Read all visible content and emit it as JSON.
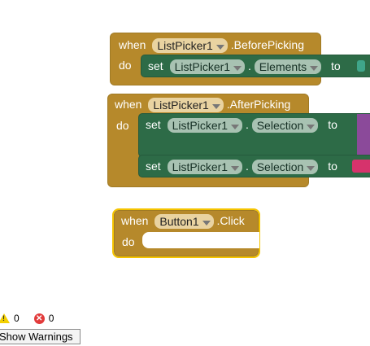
{
  "block1": {
    "when": "when",
    "component": "ListPicker1",
    "event": ".BeforePicking",
    "do": "do"
  },
  "block1_set": {
    "set": "set",
    "component": "ListPicker1",
    "dot": ".",
    "property": "Elements",
    "to": "to"
  },
  "block2": {
    "when": "when",
    "component": "ListPicker1",
    "event": ".AfterPicking",
    "do": "do"
  },
  "block2_set1": {
    "set": "set",
    "component": "ListPicker1",
    "dot": ".",
    "property": "Selection",
    "to": "to"
  },
  "block2_set2": {
    "set": "set",
    "component": "ListPicker1",
    "dot": ".",
    "property": "Selection",
    "to": "to"
  },
  "block3": {
    "when": "when",
    "component": "Button1",
    "event": ".Click",
    "do": "do"
  },
  "warnings": {
    "warning_count": "0",
    "error_count": "0",
    "button_label": "Show Warnings"
  },
  "colors": {
    "event_block": "#b6892b",
    "setter_block": "#2d6b47",
    "value_block_cyan": "#3fa58a",
    "value_block_purple": "#8b4a9a",
    "value_block_pink": "#d6336c",
    "selected_outline": "#f5c400"
  }
}
